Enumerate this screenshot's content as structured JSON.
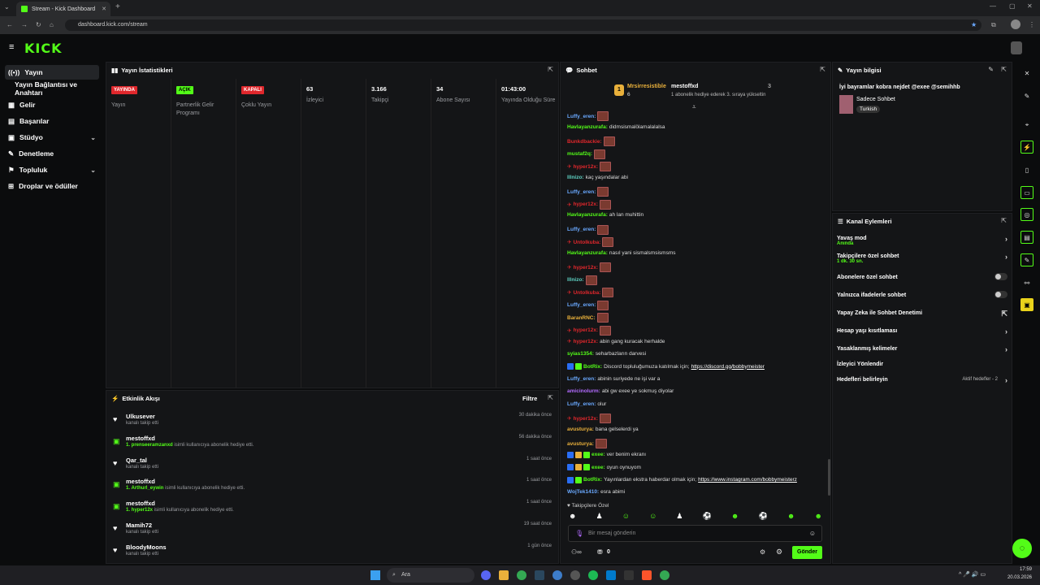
{
  "browser": {
    "tab_title": "Stream - Kick Dashboard",
    "url": "dashboard.kick.com/stream"
  },
  "brand": {
    "logo": "KICK",
    "accent": "#53fc18"
  },
  "sidebar": {
    "items": [
      {
        "label": "Yayın",
        "icon": "broadcast-icon"
      },
      {
        "label": "Yayın Bağlantısı ve Anahtarı"
      },
      {
        "label": "Gelir",
        "icon": "money-icon"
      },
      {
        "label": "Başarılar",
        "icon": "trophy-icon"
      },
      {
        "label": "Stüdyo",
        "icon": "studio-icon"
      },
      {
        "label": "Denetleme",
        "icon": "wrench-icon"
      },
      {
        "label": "Topluluk",
        "icon": "community-icon"
      },
      {
        "label": "Droplar ve ödüller",
        "icon": "gift-icon"
      }
    ]
  },
  "stats": {
    "title": "Yayın İstatistikleri",
    "items": [
      {
        "value": "YAYINDA",
        "label": "Yayın",
        "color": "#e0272c"
      },
      {
        "value": "AÇIK",
        "label": "Partnerlik Gelir Programı",
        "color": "#53fc18"
      },
      {
        "value": "KAPALI",
        "label": "Çoklu Yayın",
        "color": "#e0272c"
      },
      {
        "value": "63",
        "label": "İzleyici"
      },
      {
        "value": "3.166",
        "label": "Takipçi"
      },
      {
        "value": "34",
        "label": "Abone Sayısı"
      },
      {
        "value": "01:43:00",
        "label": "Yayında Olduğu Süre"
      }
    ]
  },
  "activity": {
    "title": "Etkinlik Akışı",
    "filter": "Filtre",
    "items": [
      {
        "name": "Ulkusever",
        "sub": "kanalı takip etti",
        "highlight": "",
        "time": "30 dakika önce",
        "icon": "heart-icon"
      },
      {
        "name": "mestoffxd",
        "highlight": "1. prenseeramzanxd",
        "sub": " isimli kullanıcıya abonelik hediye etti.",
        "time": "56 dakika önce",
        "icon": "gift-icon"
      },
      {
        "name": "Qar_tal",
        "sub": "kanalı takip etti",
        "highlight": "",
        "time": "1 saat önce",
        "icon": "heart-icon"
      },
      {
        "name": "mestoffxd",
        "highlight": "1. Arthurl_eywin",
        "sub": " isimli kullanıcıya abonelik hediye etti.",
        "time": "1 saat önce",
        "icon": "gift-icon"
      },
      {
        "name": "mestoffxd",
        "highlight": "1. hyper12x",
        "sub": " isimli kullanıcıya abonelik hediye etti.",
        "time": "1 saat önce",
        "icon": "gift-icon"
      },
      {
        "name": "Mamih72",
        "sub": "kanalı takip etti",
        "highlight": "",
        "time": "19 saat önce",
        "icon": "heart-icon"
      },
      {
        "name": "BloodyMoons",
        "sub": "kanalı takip etti",
        "highlight": "",
        "time": "1 gün önce",
        "icon": "heart-icon"
      }
    ]
  },
  "chat": {
    "title": "Sohbet",
    "pinned": {
      "user1": "Mrsirresistible",
      "count1": "6",
      "user2": "mestoffxd",
      "count2": "3",
      "text": "1 abonelik hediye ederek 3. sıraya yükseltin"
    },
    "messages": [
      {
        "user": "Luffy_eren",
        "color": "#6aa9ff",
        "text": "",
        "emote": true
      },
      {
        "user": "Havlayanzurafa",
        "color": "#53fc18",
        "text": "didmsismalölamalalalsa",
        "emote": false
      },
      {
        "user": "Bunkdbackie",
        "color": "#e0272c",
        "text": "",
        "emote": true
      },
      {
        "user": "mustaf2q",
        "color": "#53fc18",
        "text": "",
        "emote": true
      },
      {
        "user": "hyper12x",
        "color": "#e0272c",
        "text": "",
        "emote": true,
        "badge": true
      },
      {
        "user": "lllnizo",
        "color": "#5fd3c4",
        "text": "kaç yaşındalar abi",
        "emote": false
      },
      {
        "user": "Luffy_eren",
        "color": "#6aa9ff",
        "text": "",
        "emote": true
      },
      {
        "user": "hyper12x",
        "color": "#e0272c",
        "text": "",
        "emote": true,
        "badge": true
      },
      {
        "user": "Havlayanzurafa",
        "color": "#53fc18",
        "text": "ah lan muhittin",
        "emote": false
      },
      {
        "user": "Luffy_eren",
        "color": "#6aa9ff",
        "text": "",
        "emote": true
      },
      {
        "user": "Untolkuba",
        "color": "#e0272c",
        "text": "",
        "emote": true,
        "badge": true
      },
      {
        "user": "Havlayanzurafa",
        "color": "#53fc18",
        "text": "nasıl yani sismalsmsismsms",
        "emote": false
      },
      {
        "user": "hyper12x",
        "color": "#e0272c",
        "text": "",
        "emote": true,
        "badge": true
      },
      {
        "user": "lllnizo",
        "color": "#5fd3c4",
        "text": "",
        "emote": true
      },
      {
        "user": "Untolkuba",
        "color": "#e0272c",
        "text": "",
        "emote": true,
        "badge": true
      },
      {
        "user": "Luffy_eren",
        "color": "#6aa9ff",
        "text": "",
        "emote": true
      },
      {
        "user": "BaranRNC",
        "color": "#e9b03b",
        "text": "",
        "emote": true
      },
      {
        "user": "hyper12x",
        "color": "#e0272c",
        "text": "",
        "emote": true,
        "badge": true
      },
      {
        "user": "hyper12x",
        "color": "#e0272c",
        "text": "abin gang kuracak herhalde",
        "emote": false,
        "badge": true
      },
      {
        "user": "syias1354",
        "color": "#53fc18",
        "text": "seharbazların darvesi",
        "emote": false
      },
      {
        "user": "BotRix",
        "color": "#53fc18",
        "text": "Discord topluluğumuza katılmak için; ",
        "link": "https://discord.gg/bobbymeister",
        "emote": false,
        "bot": true
      },
      {
        "user": "Luffy_eren",
        "color": "#6aa9ff",
        "text": "abinin suriyede ne işi var a",
        "emote": false
      },
      {
        "user": "amicinolurm",
        "color": "#b36bff",
        "text": "abi gw exee ye sokmuş diyolar",
        "emote": false
      },
      {
        "user": "Luffy_eren",
        "color": "#6aa9ff",
        "text": "olur",
        "emote": false
      },
      {
        "user": "hyper12x",
        "color": "#e0272c",
        "text": "",
        "emote": true,
        "badge": true
      },
      {
        "user": "avusturya",
        "color": "#e9b03b",
        "text": "bana gelselerdi ya",
        "emote": false
      },
      {
        "user": "avusturya",
        "color": "#e9b03b",
        "text": "",
        "emote": true
      },
      {
        "user": "exee",
        "color": "#53fc18",
        "text": "ver benim ekranı",
        "emote": false,
        "mod": true
      },
      {
        "user": "exee",
        "color": "#53fc18",
        "text": "oyun oynuyom",
        "emote": false,
        "mod": true
      },
      {
        "user": "BotRix",
        "color": "#53fc18",
        "text": "Yayınlardan ekstra haberdar olmak için; ",
        "link": "https://www.instagram.com/bobbymeisterz",
        "emote": false,
        "bot": true
      },
      {
        "user": "WojTek1410",
        "color": "#6aa9ff",
        "text": "esra abimi",
        "emote": false
      }
    ],
    "followers_only": "Takipçilere Özel",
    "input_placeholder": "Bir mesaj gönderin",
    "points": "0",
    "send_label": "Gönder"
  },
  "stream_info": {
    "title": "Yayın bilgisi",
    "stream_title": "İyi bayramlar kobra nejdet @exee @semihhb",
    "category": "Sadece Sohbet",
    "language": "Turkish"
  },
  "channel_actions": {
    "title": "Kanal Eylemleri",
    "items": [
      {
        "label": "Yavaş mod",
        "sub": "Anında",
        "type": "arrow"
      },
      {
        "label": "Takipçilere özel sohbet",
        "sub": "1 dk. 30 sn.",
        "type": "arrow"
      },
      {
        "label": "Abonelere özel sohbet",
        "sub": "",
        "type": "toggle"
      },
      {
        "label": "Yalnızca ifadelerle sohbet",
        "sub": "",
        "type": "toggle"
      },
      {
        "label": "Yapay Zeka ile Sohbet Denetimi",
        "sub": "",
        "type": "external"
      },
      {
        "label": "Hesap yaşı kısıtlaması",
        "sub": "",
        "type": "arrow"
      },
      {
        "label": "Yasaklanmış kelimeler",
        "sub": "",
        "type": "arrow"
      },
      {
        "label": "İzleyici Yönlendir",
        "sub": "",
        "type": "none"
      },
      {
        "label": "Hedefleri belirleyin",
        "sub": "",
        "type": "arrow",
        "extra": "Aktif hedefler - 2"
      }
    ]
  },
  "taskbar": {
    "search": "Ara",
    "time": "17:59",
    "date": "20.03.2026"
  }
}
